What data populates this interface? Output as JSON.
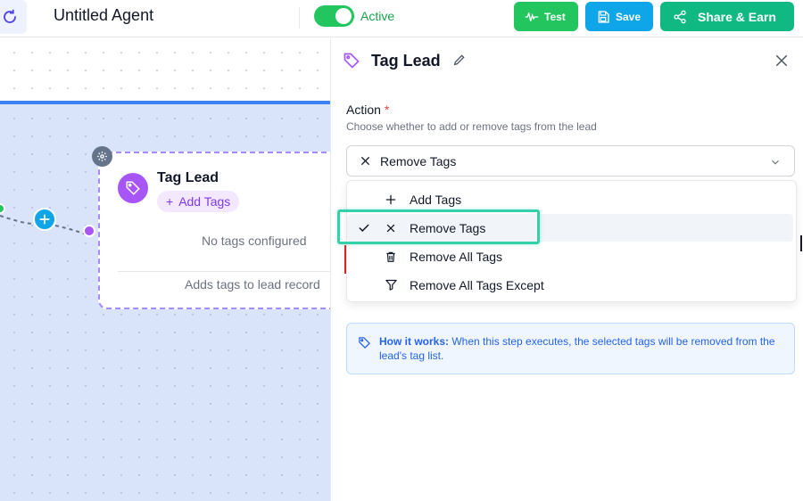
{
  "header": {
    "agent_name": "Untitled Agent",
    "status_label": "Active",
    "test_label": "Test",
    "save_label": "Save",
    "share_label": "Share & Earn"
  },
  "canvas": {
    "node": {
      "title": "Tag Lead",
      "add_tags_label": "Add Tags",
      "empty_text": "No tags configured",
      "footer_text": "Adds tags to lead record"
    }
  },
  "panel": {
    "title": "Tag Lead",
    "action_label": "Action",
    "required_mark": "*",
    "action_description": "Choose whether to add or remove tags from the lead",
    "selected_value": "Remove Tags",
    "options": [
      {
        "label": "Add Tags",
        "icon": "plus-icon",
        "selected": false
      },
      {
        "label": "Remove Tags",
        "icon": "x-icon",
        "selected": true
      },
      {
        "label": "Remove All Tags",
        "icon": "trash-icon",
        "selected": false
      },
      {
        "label": "Remove All Tags Except",
        "icon": "filter-icon",
        "selected": false
      }
    ],
    "info": {
      "bold": "How it works:",
      "text": " When this step executes, the selected tags will be removed from the lead's tag list."
    }
  },
  "colors": {
    "accent_purple": "#a855f7",
    "active_green": "#22c55e",
    "save_blue": "#0ea5e9",
    "share_green": "#10b981",
    "highlight": "#34d0a7"
  }
}
